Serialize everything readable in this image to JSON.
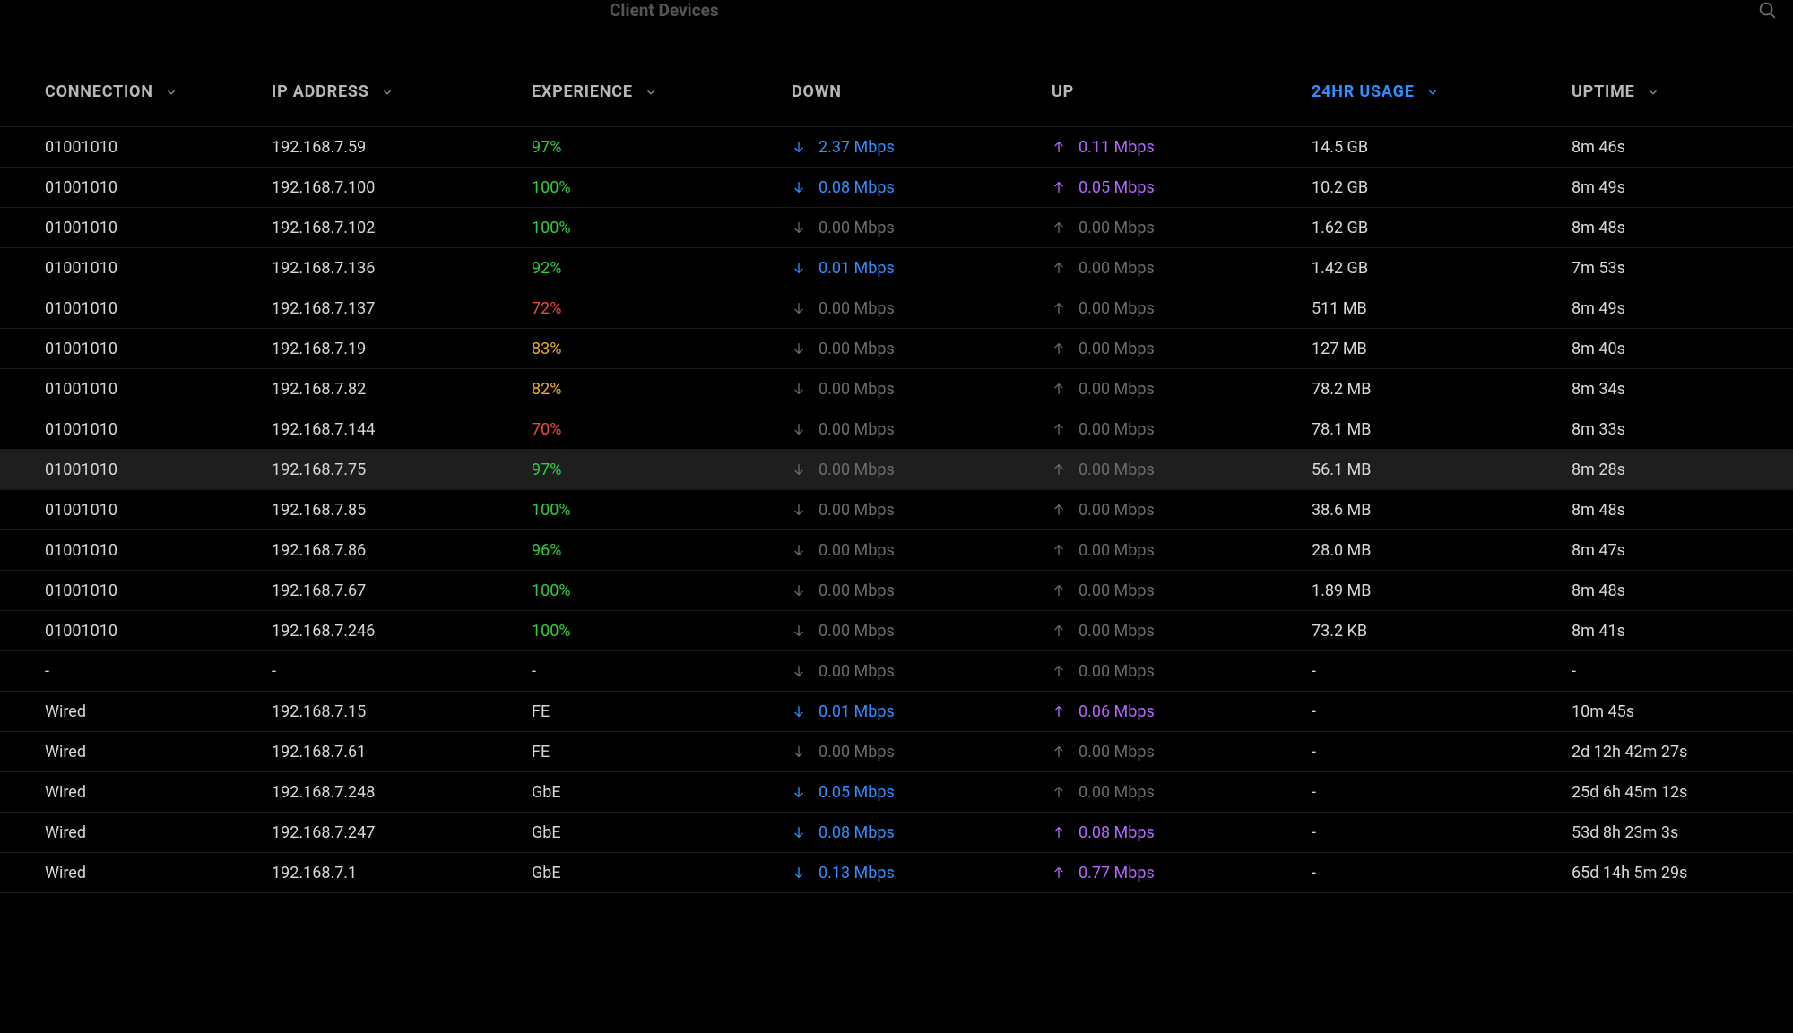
{
  "header": {
    "title": "Client Devices"
  },
  "columns": {
    "connection": "CONNECTION",
    "ip": "IP ADDRESS",
    "experience": "EXPERIENCE",
    "down": "DOWN",
    "up": "UP",
    "usage": "24HR USAGE",
    "uptime": "UPTIME"
  },
  "sorted_column": "usage",
  "rows": [
    {
      "conn": "01001010",
      "ip": "192.168.7.59",
      "exp": "97%",
      "exp_class": "green",
      "down": "2.37 Mbps",
      "down_active": true,
      "up": "0.11 Mbps",
      "up_active": true,
      "usage": "14.5 GB",
      "uptime": "8m 46s",
      "hovered": false
    },
    {
      "conn": "01001010",
      "ip": "192.168.7.100",
      "exp": "100%",
      "exp_class": "green",
      "down": "0.08 Mbps",
      "down_active": true,
      "up": "0.05 Mbps",
      "up_active": true,
      "usage": "10.2 GB",
      "uptime": "8m 49s",
      "hovered": false
    },
    {
      "conn": "01001010",
      "ip": "192.168.7.102",
      "exp": "100%",
      "exp_class": "green",
      "down": "0.00 Mbps",
      "down_active": false,
      "up": "0.00 Mbps",
      "up_active": false,
      "usage": "1.62 GB",
      "uptime": "8m 48s",
      "hovered": false
    },
    {
      "conn": "01001010",
      "ip": "192.168.7.136",
      "exp": "92%",
      "exp_class": "green",
      "down": "0.01 Mbps",
      "down_active": true,
      "up": "0.00 Mbps",
      "up_active": false,
      "usage": "1.42 GB",
      "uptime": "7m 53s",
      "hovered": false
    },
    {
      "conn": "01001010",
      "ip": "192.168.7.137",
      "exp": "72%",
      "exp_class": "red",
      "down": "0.00 Mbps",
      "down_active": false,
      "up": "0.00 Mbps",
      "up_active": false,
      "usage": "511 MB",
      "uptime": "8m 49s",
      "hovered": false
    },
    {
      "conn": "01001010",
      "ip": "192.168.7.19",
      "exp": "83%",
      "exp_class": "yellow",
      "down": "0.00 Mbps",
      "down_active": false,
      "up": "0.00 Mbps",
      "up_active": false,
      "usage": "127 MB",
      "uptime": "8m 40s",
      "hovered": false
    },
    {
      "conn": "01001010",
      "ip": "192.168.7.82",
      "exp": "82%",
      "exp_class": "yellow",
      "down": "0.00 Mbps",
      "down_active": false,
      "up": "0.00 Mbps",
      "up_active": false,
      "usage": "78.2 MB",
      "uptime": "8m 34s",
      "hovered": false
    },
    {
      "conn": "01001010",
      "ip": "192.168.7.144",
      "exp": "70%",
      "exp_class": "red",
      "down": "0.00 Mbps",
      "down_active": false,
      "up": "0.00 Mbps",
      "up_active": false,
      "usage": "78.1 MB",
      "uptime": "8m 33s",
      "hovered": false
    },
    {
      "conn": "01001010",
      "ip": "192.168.7.75",
      "exp": "97%",
      "exp_class": "green",
      "down": "0.00 Mbps",
      "down_active": false,
      "up": "0.00 Mbps",
      "up_active": false,
      "usage": "56.1 MB",
      "uptime": "8m 28s",
      "hovered": true
    },
    {
      "conn": "01001010",
      "ip": "192.168.7.85",
      "exp": "100%",
      "exp_class": "green",
      "down": "0.00 Mbps",
      "down_active": false,
      "up": "0.00 Mbps",
      "up_active": false,
      "usage": "38.6 MB",
      "uptime": "8m 48s",
      "hovered": false
    },
    {
      "conn": "01001010",
      "ip": "192.168.7.86",
      "exp": "96%",
      "exp_class": "green",
      "down": "0.00 Mbps",
      "down_active": false,
      "up": "0.00 Mbps",
      "up_active": false,
      "usage": "28.0 MB",
      "uptime": "8m 47s",
      "hovered": false
    },
    {
      "conn": "01001010",
      "ip": "192.168.7.67",
      "exp": "100%",
      "exp_class": "green",
      "down": "0.00 Mbps",
      "down_active": false,
      "up": "0.00 Mbps",
      "up_active": false,
      "usage": "1.89 MB",
      "uptime": "8m 48s",
      "hovered": false
    },
    {
      "conn": "01001010",
      "ip": "192.168.7.246",
      "exp": "100%",
      "exp_class": "green",
      "down": "0.00 Mbps",
      "down_active": false,
      "up": "0.00 Mbps",
      "up_active": false,
      "usage": "73.2 KB",
      "uptime": "8m 41s",
      "hovered": false
    },
    {
      "conn": "-",
      "ip": "-",
      "exp": "-",
      "exp_class": "",
      "down": "0.00 Mbps",
      "down_active": false,
      "up": "0.00 Mbps",
      "up_active": false,
      "usage": "-",
      "uptime": "-",
      "hovered": false
    },
    {
      "conn": "Wired",
      "ip": "192.168.7.15",
      "exp": "FE",
      "exp_class": "",
      "down": "0.01 Mbps",
      "down_active": true,
      "up": "0.06 Mbps",
      "up_active": true,
      "usage": "-",
      "uptime": "10m 45s",
      "hovered": false
    },
    {
      "conn": "Wired",
      "ip": "192.168.7.61",
      "exp": "FE",
      "exp_class": "",
      "down": "0.00 Mbps",
      "down_active": false,
      "up": "0.00 Mbps",
      "up_active": false,
      "usage": "-",
      "uptime": "2d 12h 42m 27s",
      "hovered": false
    },
    {
      "conn": "Wired",
      "ip": "192.168.7.248",
      "exp": "GbE",
      "exp_class": "",
      "down": "0.05 Mbps",
      "down_active": true,
      "up": "0.00 Mbps",
      "up_active": false,
      "usage": "-",
      "uptime": "25d 6h 45m 12s",
      "hovered": false
    },
    {
      "conn": "Wired",
      "ip": "192.168.7.247",
      "exp": "GbE",
      "exp_class": "",
      "down": "0.08 Mbps",
      "down_active": true,
      "up": "0.08 Mbps",
      "up_active": true,
      "usage": "-",
      "uptime": "53d 8h 23m 3s",
      "hovered": false
    },
    {
      "conn": "Wired",
      "ip": "192.168.7.1",
      "exp": "GbE",
      "exp_class": "",
      "down": "0.13 Mbps",
      "down_active": true,
      "up": "0.77 Mbps",
      "up_active": true,
      "usage": "-",
      "uptime": "65d 14h 5m 29s",
      "hovered": false
    }
  ]
}
